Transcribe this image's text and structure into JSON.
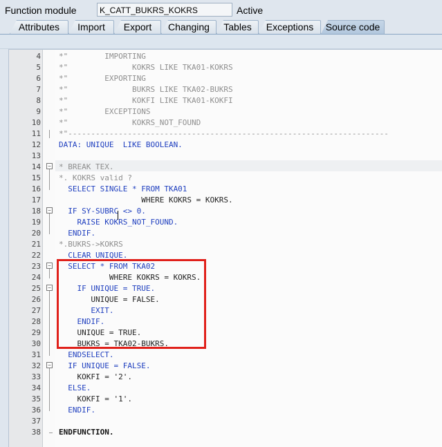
{
  "header": {
    "function_module_label": "Function module",
    "function_module_value": "K_CATT_BUKRS_KOKRS",
    "status": "Active"
  },
  "tabs": [
    {
      "label": "Attributes",
      "active": false
    },
    {
      "label": "Import",
      "active": false
    },
    {
      "label": "Export",
      "active": false
    },
    {
      "label": "Changing",
      "active": false
    },
    {
      "label": "Tables",
      "active": false
    },
    {
      "label": "Exceptions",
      "active": false
    },
    {
      "label": "Source code",
      "active": true
    }
  ],
  "editor": {
    "lines": [
      {
        "no": "4",
        "text": "*\"        IMPORTING"
      },
      {
        "no": "5",
        "text": "*\"              KOKRS LIKE TKA01-KOKRS"
      },
      {
        "no": "6",
        "text": "*\"        EXPORTING"
      },
      {
        "no": "7",
        "text": "*\"              BUKRS LIKE TKA02-BUKRS"
      },
      {
        "no": "8",
        "text": "*\"              KOKFI LIKE TKA01-KOKFI"
      },
      {
        "no": "9",
        "text": "*\"        EXCEPTIONS"
      },
      {
        "no": "10",
        "text": "*\"              KOKRS_NOT_FOUND"
      },
      {
        "no": "11",
        "text": "*\"----------------------------------------------------------------------"
      },
      {
        "no": "12",
        "text": "DATA: UNIQUE  LIKE BOOLEAN."
      },
      {
        "no": "13",
        "text": ""
      },
      {
        "no": "14",
        "text": "* BREAK TEX."
      },
      {
        "no": "15",
        "text": "*. KOKRS valid ?"
      },
      {
        "no": "16",
        "text": "  SELECT SINGLE * FROM TKA01"
      },
      {
        "no": "17",
        "text": "                  WHERE KOKRS = KOKRS."
      },
      {
        "no": "18",
        "text": "  IF SY-SUBRC <> 0."
      },
      {
        "no": "19",
        "text": "    RAISE KOKRS_NOT_FOUND."
      },
      {
        "no": "20",
        "text": "  ENDIF."
      },
      {
        "no": "21",
        "text": "*.BUKRS->KOKRS"
      },
      {
        "no": "22",
        "text": "  CLEAR UNIQUE."
      },
      {
        "no": "23",
        "text": "  SELECT * FROM TKA02"
      },
      {
        "no": "24",
        "text": "           WHERE KOKRS = KOKRS."
      },
      {
        "no": "25",
        "text": "    IF UNIQUE = TRUE."
      },
      {
        "no": "26",
        "text": "       UNIQUE = FALSE."
      },
      {
        "no": "27",
        "text": "       EXIT."
      },
      {
        "no": "28",
        "text": "    ENDIF."
      },
      {
        "no": "29",
        "text": "    UNIQUE = TRUE."
      },
      {
        "no": "30",
        "text": "    BUKRS = TKA02-BUKRS."
      },
      {
        "no": "31",
        "text": "  ENDSELECT."
      },
      {
        "no": "32",
        "text": "  IF UNIQUE = FALSE."
      },
      {
        "no": "33",
        "text": "    KOKFI = '2'."
      },
      {
        "no": "34",
        "text": "  ELSE."
      },
      {
        "no": "35",
        "text": "    KOKFI = '1'."
      },
      {
        "no": "36",
        "text": "  ENDIF."
      },
      {
        "no": "37",
        "text": ""
      },
      {
        "no": "38",
        "text": "ENDFUNCTION."
      }
    ]
  },
  "annotation_color": "#e0201a"
}
